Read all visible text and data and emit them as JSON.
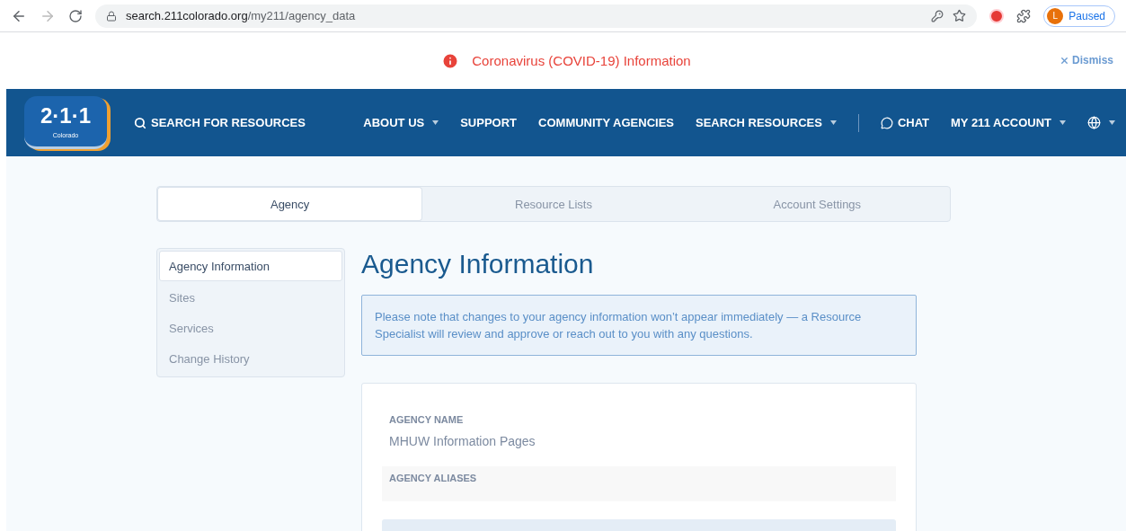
{
  "browser": {
    "url_host": "search.211colorado.org",
    "url_path": "/my211/agency_data",
    "profile_initial": "L",
    "profile_status": "Paused"
  },
  "banner": {
    "message": "Coronavirus (COVID-19) Information",
    "dismiss": "Dismiss"
  },
  "nav": {
    "logo_number": "2·1·1",
    "logo_region": "Colorado",
    "search_link": "SEARCH FOR RESOURCES",
    "items": [
      {
        "label": "ABOUT US",
        "dropdown": true,
        "kind": "link"
      },
      {
        "label": "SUPPORT",
        "dropdown": false,
        "kind": "link"
      },
      {
        "label": "COMMUNITY AGENCIES",
        "dropdown": false,
        "kind": "link"
      },
      {
        "label": "SEARCH RESOURCES",
        "dropdown": true,
        "kind": "link"
      },
      {
        "label": "CHAT",
        "dropdown": false,
        "kind": "chat"
      },
      {
        "label": "MY 211 ACCOUNT",
        "dropdown": true,
        "kind": "link"
      },
      {
        "dropdown": true,
        "kind": "globe"
      }
    ]
  },
  "tabs": [
    {
      "label": "Agency",
      "selected": true
    },
    {
      "label": "Resource Lists",
      "selected": false
    },
    {
      "label": "Account Settings",
      "selected": false
    }
  ],
  "sidebar": {
    "items": [
      {
        "label": "Agency Information",
        "selected": true
      },
      {
        "label": "Sites",
        "selected": false
      },
      {
        "label": "Services",
        "selected": false
      },
      {
        "label": "Change History",
        "selected": false
      }
    ]
  },
  "main": {
    "title": "Agency Information",
    "notice": "Please note that changes to your agency information won’t appear immediately — a Resource Specialist will review and approve or reach out to you with any questions.",
    "fields": [
      {
        "label": "AGENCY NAME",
        "value": "MHUW Information Pages",
        "shaded": false
      },
      {
        "label": "AGENCY ALIASES",
        "shaded": true
      }
    ]
  }
}
